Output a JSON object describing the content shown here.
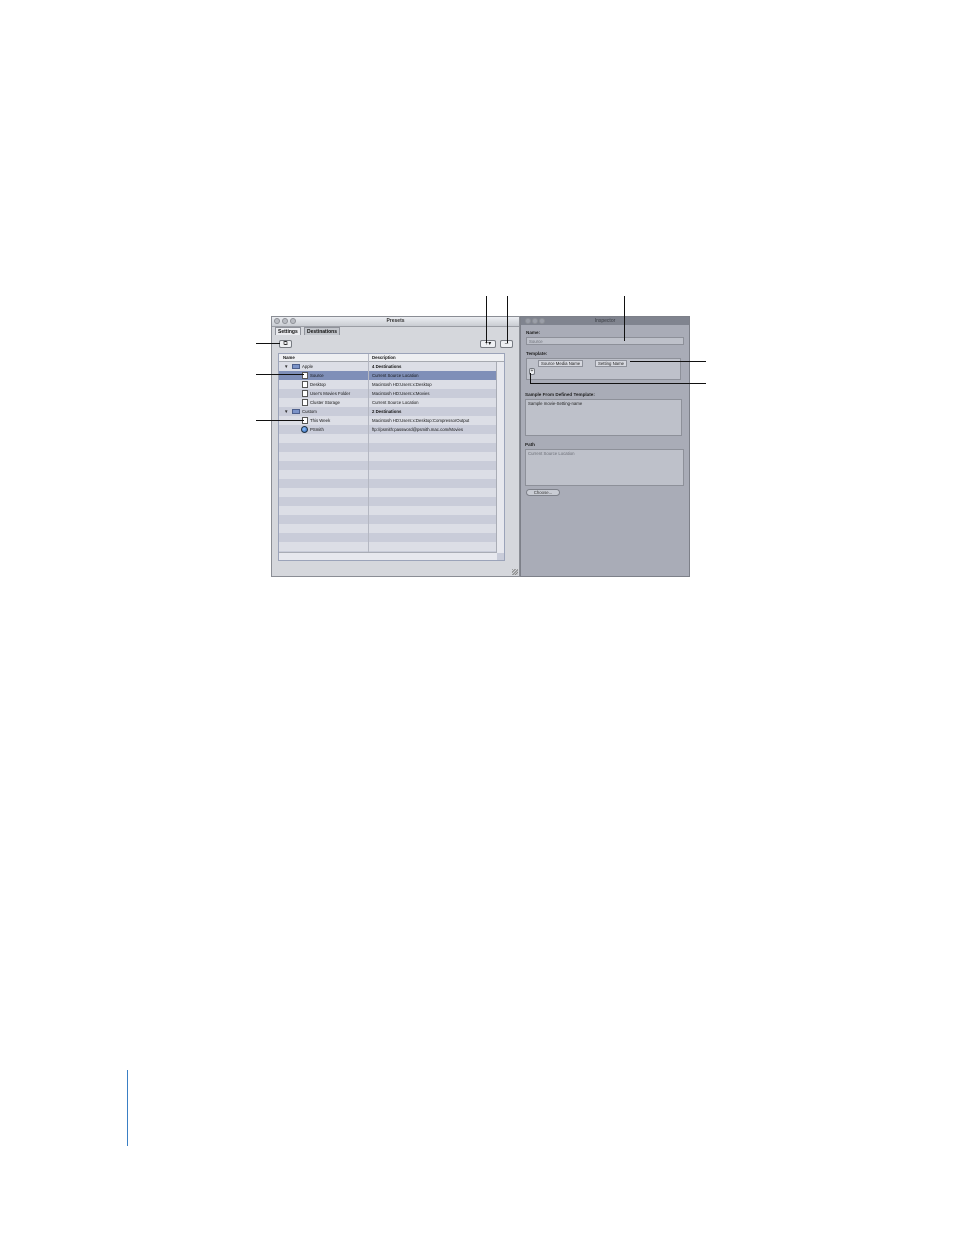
{
  "presets_window": {
    "title": "Presets",
    "tabs": [
      {
        "label": "Settings"
      },
      {
        "label": "Destinations"
      }
    ],
    "add_button_label": "+▾",
    "remove_button_label": "–",
    "table": {
      "headers": {
        "name": "Name",
        "description": "Description"
      },
      "rows": [
        {
          "name": "Apple",
          "description": "4 Destinations"
        },
        {
          "name": "Source",
          "description": "Current Source Location"
        },
        {
          "name": "Desktop",
          "description": "Macintosh HD:Users:x:Desktop"
        },
        {
          "name": "User's Movies Folder",
          "description": "Macintosh HD:Users:x:Movies"
        },
        {
          "name": "Cluster Storage",
          "description": "Current Source Location"
        },
        {
          "name": "Custom",
          "description": "2 Destinations"
        },
        {
          "name": "This Week",
          "description": "Macintosh HD:Users:x:Desktop:CompressorOutput"
        },
        {
          "name": "PSmith",
          "description": "ftp://psmith:password@psmith.mac.com/Movies"
        }
      ]
    }
  },
  "inspector_window": {
    "title": "Inspector",
    "name_label": "Name:",
    "name_value": "Source",
    "template_label": "Template:",
    "template_tokens": [
      "Source Media Name",
      "Setting Name"
    ],
    "add_token_label": "+",
    "sample_label": "Sample From Defined Template:",
    "sample_value": "Sample movie-Setting-name",
    "path_label": "Path",
    "path_value": "Current Source Location",
    "choose_label": "Choose..."
  }
}
